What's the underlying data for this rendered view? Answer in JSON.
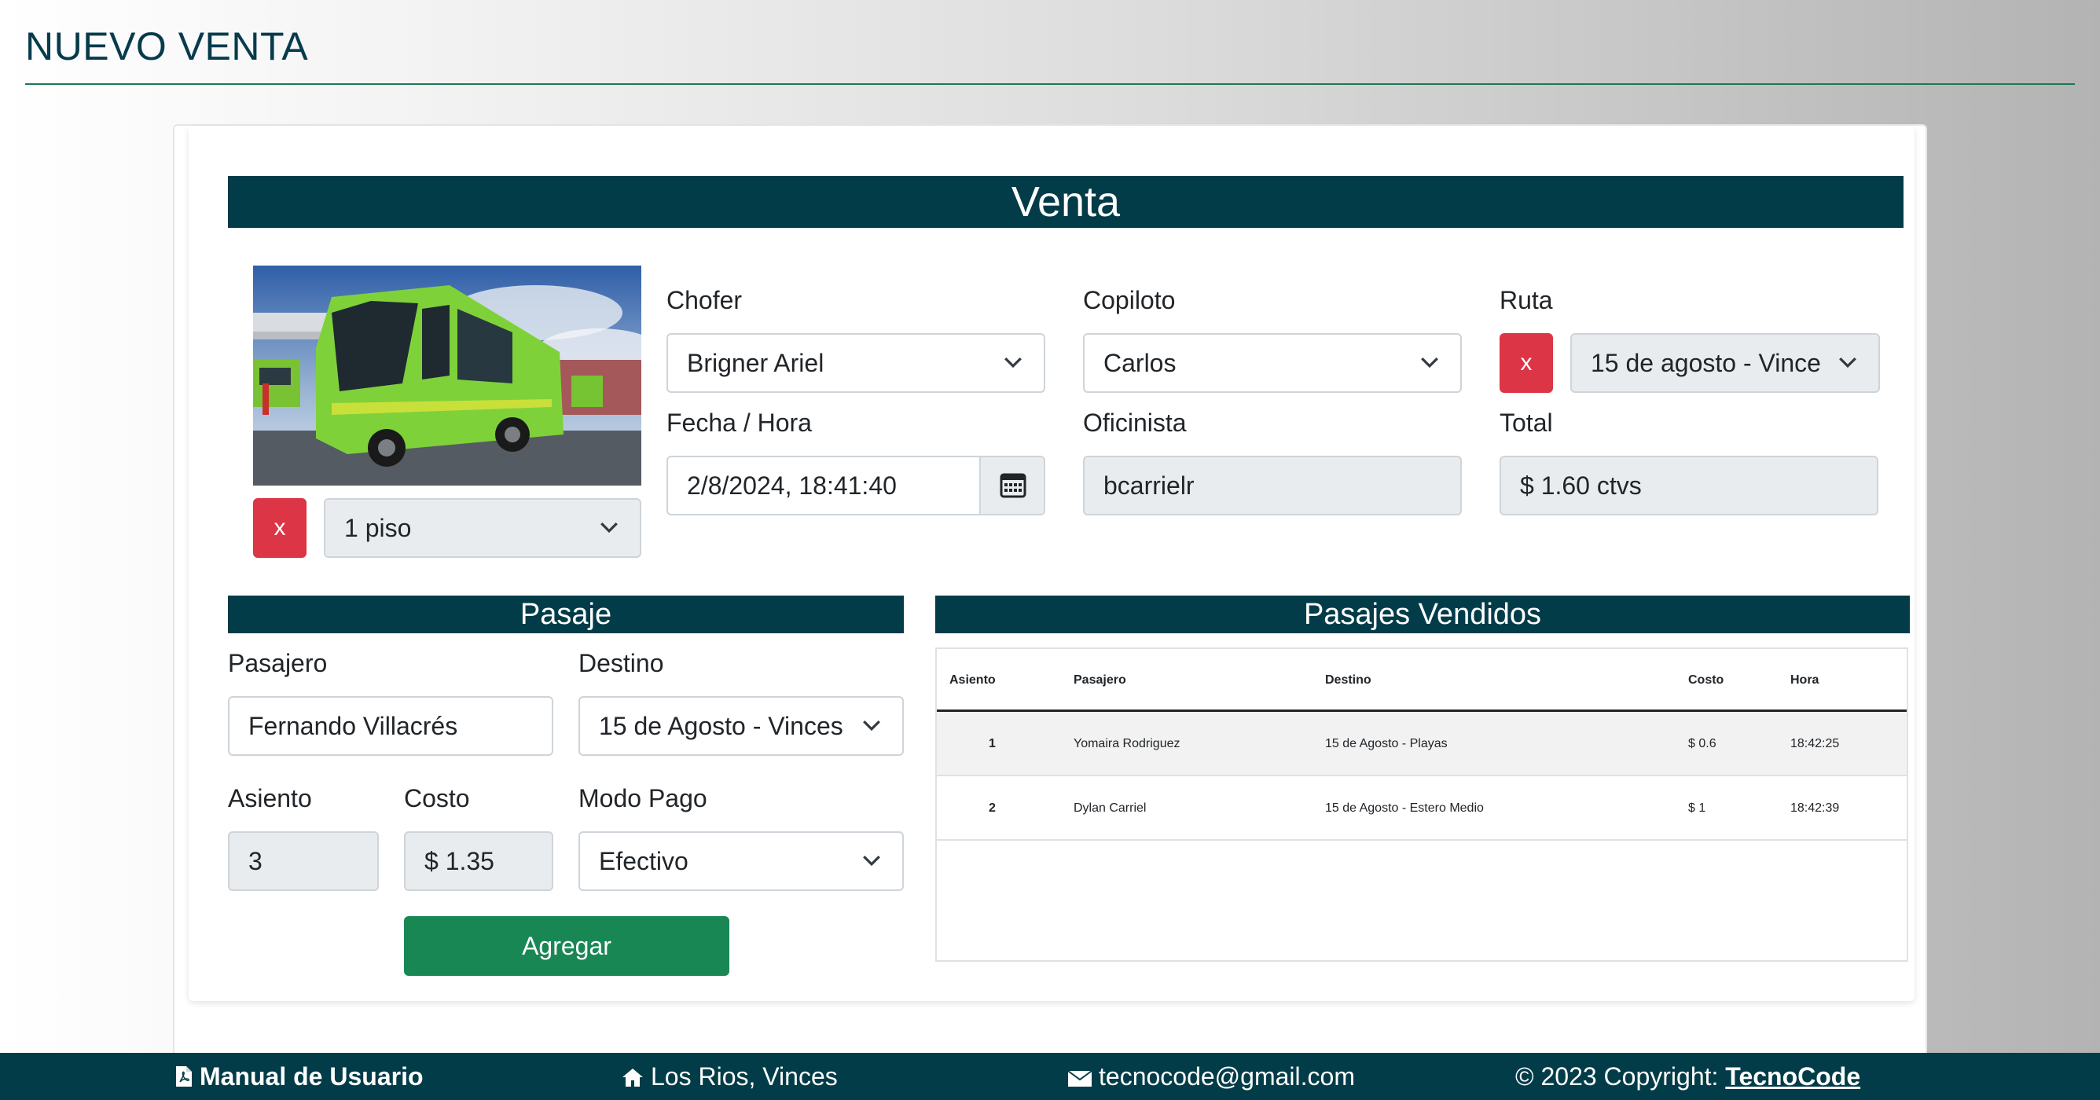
{
  "page": {
    "title": "NUEVO VENTA"
  },
  "venta": {
    "header": "Venta",
    "bus_image": "bus-photo",
    "piso": {
      "remove_label": "x",
      "selected": "1 piso"
    },
    "chofer": {
      "label": "Chofer",
      "selected": "Brigner Ariel"
    },
    "copiloto": {
      "label": "Copiloto",
      "selected": "Carlos"
    },
    "ruta": {
      "label": "Ruta",
      "remove_label": "x",
      "selected": "15 de agosto - Vince"
    },
    "fecha": {
      "label": "Fecha / Hora",
      "value": "2/8/2024, 18:41:40"
    },
    "oficinista": {
      "label": "Oficinista",
      "value": "bcarrielr"
    },
    "total": {
      "label": "Total",
      "value": "$ 1.60 ctvs"
    }
  },
  "pasaje": {
    "header": "Pasaje",
    "pasajero": {
      "label": "Pasajero",
      "value": "Fernando Villacrés"
    },
    "destino": {
      "label": "Destino",
      "selected": "15 de Agosto - Vinces"
    },
    "asiento": {
      "label": "Asiento",
      "value": "3"
    },
    "costo": {
      "label": "Costo",
      "value": "$ 1.35"
    },
    "modo_pago": {
      "label": "Modo Pago",
      "selected": "Efectivo"
    },
    "agregar_label": "Agregar"
  },
  "vendidos": {
    "header": "Pasajes Vendidos",
    "columns": [
      "Asiento",
      "Pasajero",
      "Destino",
      "Costo",
      "Hora"
    ],
    "rows": [
      {
        "asiento": "1",
        "pasajero": "Yomaira Rodriguez",
        "destino": "15 de Agosto - Playas",
        "costo": "$ 0.6",
        "hora": "18:42:25"
      },
      {
        "asiento": "2",
        "pasajero": "Dylan Carriel",
        "destino": "15 de Agosto - Estero Medio",
        "costo": "$ 1",
        "hora": "18:42:39"
      }
    ]
  },
  "footer": {
    "manual": "Manual de Usuario",
    "location": "Los Rios, Vinces",
    "email": "tecnocode@gmail.com",
    "copyright": "© 2023 Copyright: ",
    "brand": "TecnoCode"
  },
  "colors": {
    "primary_dark": "#023c48",
    "danger": "#dc3545",
    "success": "#198754",
    "header_rule": "#1c7a52"
  }
}
